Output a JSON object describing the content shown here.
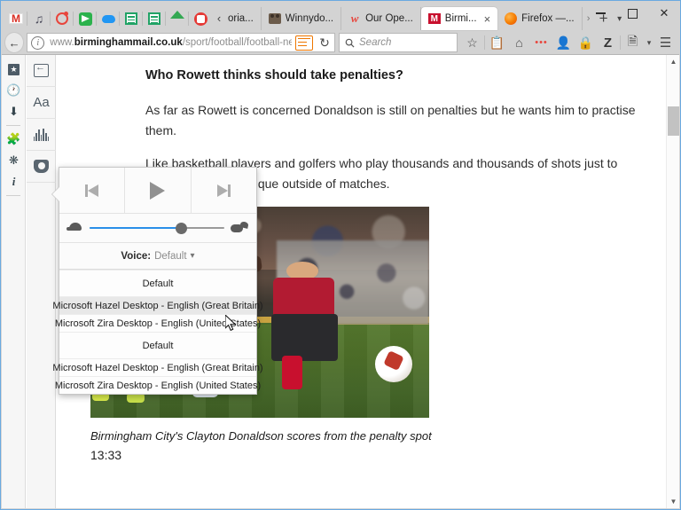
{
  "window": {
    "controls": {
      "minimize": "minimize-button",
      "maximize": "maximize-button",
      "close": "close-button"
    }
  },
  "tabstrip": {
    "pinned_icons": [
      "gmail-icon",
      "music-note-icon",
      "ring-record-icon",
      "feedly-icon",
      "cloud-icon",
      "spreadsheet-icon",
      "spreadsheet-alt-icon",
      "google-drive-icon",
      "heart-badge-icon"
    ],
    "scroll_left_label": "‹",
    "overflow_label": "›",
    "new_tab_label": "+",
    "list_all_tabs_label": "▾",
    "tabs": [
      {
        "label": "oria...",
        "favicon": "none-icon",
        "active": false,
        "partial": true
      },
      {
        "label": "Winnydo...",
        "favicon": "dog-icon",
        "active": false
      },
      {
        "label": "Our Ope...",
        "favicon": "wordpress-icon",
        "active": false
      },
      {
        "label": "Birmi...",
        "favicon": "mirror-icon",
        "active": true,
        "close": "×"
      },
      {
        "label": "Firefox —...",
        "favicon": "firefox-icon",
        "active": false
      }
    ]
  },
  "navbar": {
    "back_label": "←",
    "url_prefix": "www.",
    "url_domain": "birminghammail.co.uk",
    "url_path": "/sport/football/football-news/bi",
    "reader_icon": "reader-mode-icon",
    "reload_label": "↻",
    "search": {
      "placeholder": "Search",
      "icon": "search-icon"
    },
    "tool_icons": [
      "bookmark-star-icon",
      "library-icon",
      "home-icon",
      "pocket-dots-icon",
      "user-account-icon",
      "lock-icon",
      "zotero-icon",
      "reader-page-icon",
      "dropdown-caret-icon",
      "hamburger-menu-icon"
    ],
    "zotero_label": "Z"
  },
  "sidebar_icons": {
    "column_a": [
      "star-box-icon",
      "history-clock-icon",
      "downloads-arrow-icon",
      "addons-puzzle-icon",
      "sync-asterisk-icon",
      "page-info-icon"
    ],
    "column_b": [
      "close-reader-icon",
      "type-controls-icon",
      "narrate-icon",
      "pocket-save-icon"
    ],
    "type_label": "Aa"
  },
  "article": {
    "heading": "Who Rowett thinks should take penalties?",
    "paragraph1": "As far as Rowett is concerned Donaldson is still on penalties but he wants him to practise them.",
    "paragraph2": "Like basketball players and golfers who play thousands and thousands of shots just to entrench their technique outside of matches.",
    "photo_alt": "football-penalty-photo",
    "caption": "Birmingham City's Clayton Donaldson scores from the penalty spot",
    "timestamp": "13:33"
  },
  "narrate_popup": {
    "prev_label": "skip-back-icon",
    "play_label": "play-icon",
    "next_label": "skip-forward-icon",
    "slow_icon": "turtle-icon",
    "fast_icon": "rabbit-icon",
    "speed_percent": 68,
    "voice_label": "Voice:",
    "voice_value": "Default",
    "voice_chevron": "∨",
    "voice_options": [
      {
        "label": "Default",
        "hover": false,
        "tall": true
      },
      {
        "label": "Microsoft Hazel Desktop - English (Great Britain)",
        "hover": true,
        "tall": false
      },
      {
        "label": "Microsoft Zira Desktop - English (United States)",
        "hover": false,
        "tall": false
      },
      {
        "label": "Default",
        "hover": false,
        "tall": true
      },
      {
        "label": "Microsoft Hazel Desktop - English (Great Britain)",
        "hover": false,
        "tall": false
      },
      {
        "label": "Microsoft Zira Desktop - English (United States)",
        "hover": false,
        "tall": false
      }
    ]
  },
  "scrollbar": {
    "up_label": "▲",
    "down_label": "▼"
  },
  "colors": {
    "chrome": "#d3d3d3",
    "window_border": "#6aa9e0",
    "accent_blue": "#2a8fe8",
    "reader_orange": "#ee7600",
    "kit_red": "#c8102e"
  }
}
